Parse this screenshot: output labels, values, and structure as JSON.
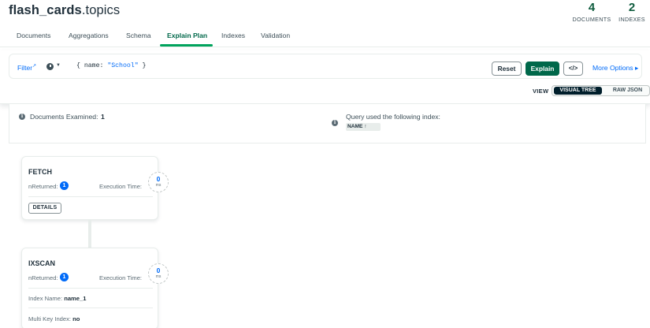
{
  "header": {
    "db_name": "flash_cards",
    "collection_name": ".topics",
    "documents_count": "4",
    "documents_label": "DOCUMENTS",
    "indexes_count": "2",
    "indexes_label": "INDEXES"
  },
  "tabs": [
    {
      "label": "Documents",
      "active": false
    },
    {
      "label": "Aggregations",
      "active": false
    },
    {
      "label": "Schema",
      "active": false
    },
    {
      "label": "Explain Plan",
      "active": true
    },
    {
      "label": "Indexes",
      "active": false
    },
    {
      "label": "Validation",
      "active": false
    }
  ],
  "query_bar": {
    "filter_label": "Filter",
    "filter_link_icon": "external-link-icon",
    "history_icon": "clock-icon",
    "query_prefix": "{ name: ",
    "query_value": "\"School\"",
    "query_suffix": " }",
    "reset_label": "Reset",
    "explain_label": "Explain",
    "code_icon": "code-icon",
    "code_label": "</>",
    "more_options_label": "More Options",
    "more_options_caret": "▸"
  },
  "view": {
    "label": "VIEW",
    "options": [
      "VISUAL TREE",
      "RAW JSON"
    ],
    "selected": "VISUAL TREE"
  },
  "summary": {
    "docs_examined_label": "Documents Examined:",
    "docs_examined_value": "1",
    "index_used_label": "Query used the following index:",
    "index_name": "NAME",
    "index_direction_icon": "arrow-up-icon",
    "index_direction_glyph": "↑"
  },
  "stages": {
    "fetch": {
      "title": "FETCH",
      "nreturned_label": "nReturned:",
      "nreturned_value": "1",
      "exec_time_label": "Execution Time:",
      "exec_time_value": "0",
      "exec_time_unit": "ms",
      "details_label": "DETAILS"
    },
    "ixscan": {
      "title": "IXSCAN",
      "nreturned_label": "nReturned:",
      "nreturned_value": "1",
      "exec_time_label": "Execution Time:",
      "exec_time_value": "0",
      "exec_time_unit": "ms",
      "index_name_label": "Index Name:",
      "index_name_value": "name_1",
      "multikey_label": "Multi Key Index:",
      "multikey_value": "no"
    }
  },
  "colors": {
    "brand_green": "#00684a",
    "accent_blue": "#016bf8",
    "tab_underline": "#00a35c",
    "dark": "#001e2b"
  }
}
